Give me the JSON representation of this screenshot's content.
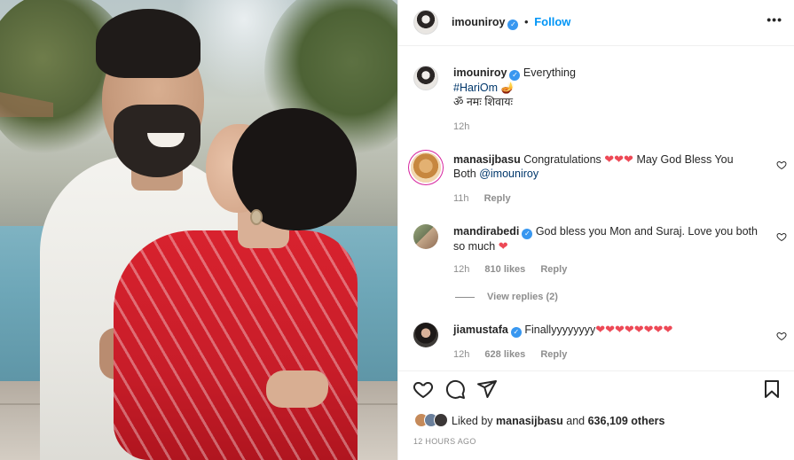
{
  "post": {
    "author": "imouniroy",
    "follow_label": "Follow",
    "separator": "•",
    "more_label": "•••"
  },
  "caption": {
    "author": "imouniroy",
    "text": "Everything",
    "hashtag": "#HariOm",
    "hashtag_emoji": "🪔",
    "line2": "ॐ नमः शिवायः",
    "time": "12h"
  },
  "comments": [
    {
      "user": "manasijbasu",
      "text_a": "Congratulations",
      "hearts_a": "❤❤❤",
      "text_b": "May God Bless You Both",
      "mention": "@imouniroy",
      "time": "11h",
      "reply_label": "Reply"
    },
    {
      "user": "mandirabedi",
      "text_a": "God bless you Mon and Suraj. Love you both so much",
      "hearts_a": "❤",
      "time": "12h",
      "likes": "810 likes",
      "reply_label": "Reply",
      "view_replies": "View replies (2)"
    },
    {
      "user": "jiamustafa",
      "text_a": "Finallyyyyyyyy",
      "hearts_a": "❤❤❤❤❤❤❤❤",
      "time": "12h",
      "likes": "628 likes",
      "reply_label": "Reply"
    }
  ],
  "likes": {
    "liked_by": "Liked by",
    "user": "manasijbasu",
    "and": "and",
    "others": "636,109 others"
  },
  "timestamp": "12 HOURS AGO",
  "colors": {
    "accent": "#0095f6",
    "heart": "#ed4956",
    "verified": "#3897f0",
    "muted": "#8e8e8e"
  },
  "icons": {
    "like": "heart-outline-icon",
    "comment": "comment-bubble-icon",
    "share": "paper-plane-icon",
    "save": "bookmark-icon",
    "comment_like": "heart-outline-icon",
    "more": "more-options-icon",
    "verified": "verified-badge-icon"
  }
}
